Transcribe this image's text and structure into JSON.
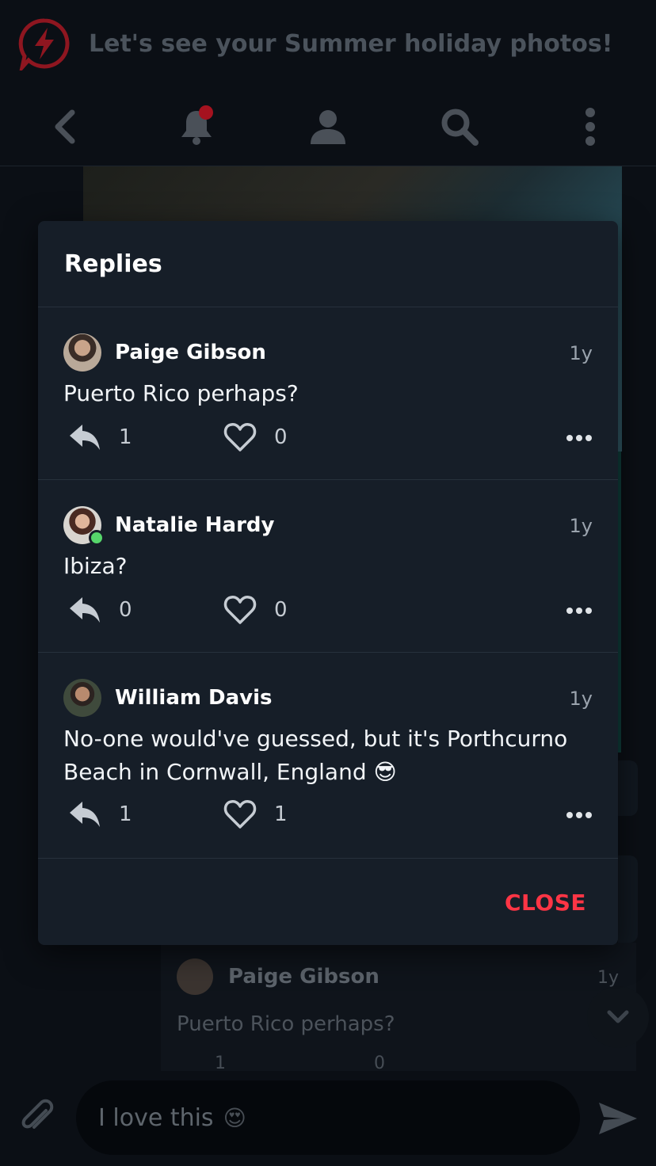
{
  "topbar": {
    "title": "Let's see your Summer holiday photos!"
  },
  "navbar": {
    "icons": [
      "back-icon",
      "bell-icon",
      "profile-icon",
      "search-icon",
      "more-vertical-icon"
    ]
  },
  "background_reply": {
    "author": "Paige Gibson",
    "time": "1y",
    "text": "Puerto Rico perhaps?",
    "replies": "1",
    "likes": "0"
  },
  "modal": {
    "title": "Replies",
    "close_label": "CLOSE",
    "replies": [
      {
        "author": "Paige Gibson",
        "time": "1y",
        "text": "Puerto Rico perhaps?",
        "reply_count": "1",
        "like_count": "0",
        "online": false
      },
      {
        "author": "Natalie Hardy",
        "time": "1y",
        "text": "Ibiza?",
        "reply_count": "0",
        "like_count": "0",
        "online": true
      },
      {
        "author": "William Davis",
        "time": "1y",
        "text": "No-one would've guessed, but it's Porthcurno Beach in Cornwall, England",
        "emoji": "😎",
        "reply_count": "1",
        "like_count": "1",
        "online": false
      }
    ]
  },
  "composer": {
    "value": "I love this",
    "emoji": "😍"
  },
  "colors": {
    "accent": "#ff3545",
    "modal_bg": "#161e28",
    "page_bg": "#0b0f15",
    "online": "#56d66b"
  }
}
